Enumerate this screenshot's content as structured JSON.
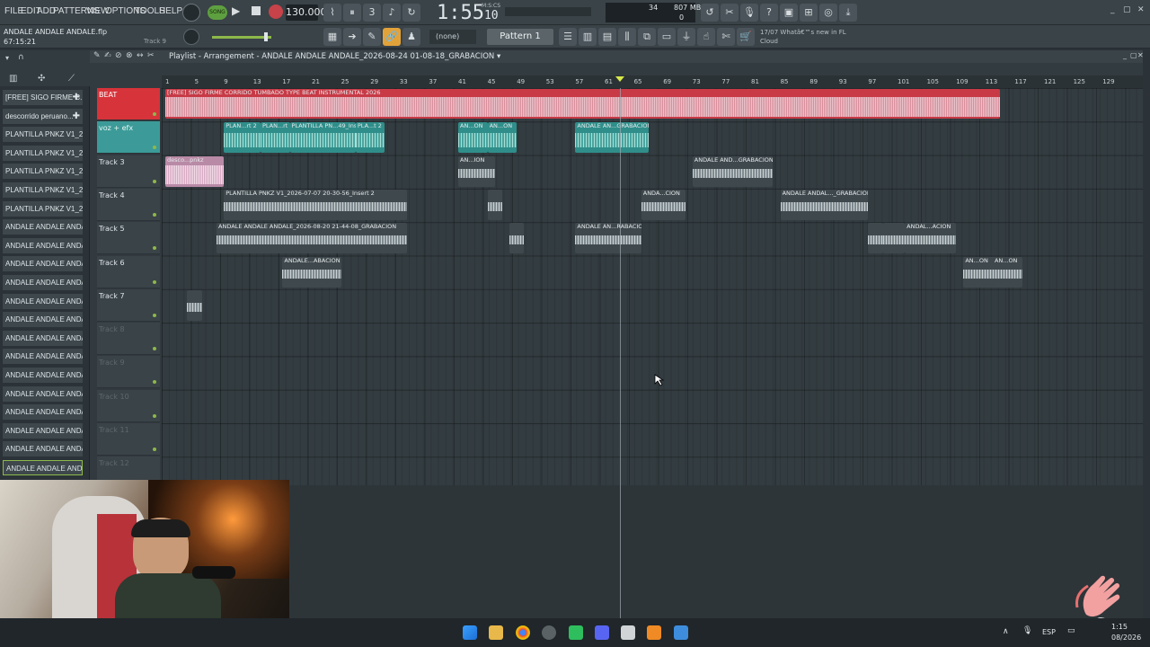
{
  "menu": [
    "FILE",
    "EDIT",
    "ADD",
    "PATTERNS",
    "VIEW",
    "OPTIONS",
    "TOOLS",
    "HELP"
  ],
  "transport": {
    "mode": "SONG",
    "tempo": "130.000",
    "time": "1:55",
    "time_frac": "10",
    "time_unit": "M:S:CS"
  },
  "monitor": {
    "cpu": "34",
    "memory": "807 MB",
    "poly": "0"
  },
  "project": {
    "name": "ANDALE ANDALE ANDALE.flp",
    "time": "67:15:21",
    "track": "Track 9"
  },
  "snap": "(none)",
  "pattern": "Pattern 1",
  "news": {
    "date": "17/07",
    "headline": "Whatâ€™s new in FL",
    "source": "Cloud"
  },
  "browser_items": [
    "[FREE] SIGO FIRME C...",
    "descorrido peruano...",
    "PLANTILLA PNKZ V1_2026...",
    "PLANTILLA PNKZ V1_2026...",
    "PLANTILLA PNKZ V1_2026...",
    "PLANTILLA PNKZ V1_2026...",
    "PLANTILLA PNKZ V1_2026...",
    "ANDALE ANDALE ANDALE_...",
    "ANDALE ANDALE ANDALE_...",
    "ANDALE ANDALE ANDALE_...",
    "ANDALE ANDALE ANDALE_...",
    "ANDALE ANDALE ANDALE_...",
    "ANDALE ANDALE ANDALE_...",
    "ANDALE ANDALE ANDALE_...",
    "ANDALE ANDALE ANDALE_...",
    "ANDALE ANDALE ANDALE_...",
    "ANDALE ANDALE ANDALE_...",
    "ANDALE ANDALE ANDALE_...",
    "ANDALE ANDALE ANDALE_...",
    "ANDALE ANDALE ANDALE_...",
    "ANDALE ANDALE ANDALE_..."
  ],
  "playlist": {
    "title": "Playlist - Arrangement",
    "arrangement": "ANDALE ANDALE ANDALE_2026-08-24 01-08-18_GRABACION",
    "ruler": [
      "1",
      "5",
      "9",
      "13",
      "17",
      "21",
      "25",
      "29",
      "33",
      "37",
      "41",
      "45",
      "49",
      "53",
      "57",
      "61",
      "65",
      "69",
      "73",
      "77",
      "81",
      "85",
      "89",
      "93",
      "97",
      "101",
      "105",
      "109",
      "113",
      "117",
      "121",
      "125",
      "129"
    ],
    "tracks": [
      "BEAT",
      "voz + efx",
      "Track 3",
      "Track 4",
      "Track 5",
      "Track 6",
      "Track 7",
      "Track 8",
      "Track 9",
      "Track 10",
      "Track 11",
      "Track 12"
    ],
    "clip_labels": {
      "beat": "[FREE] SIGO FIRME CORRIDO TUMBADO TYPE BEAT INSTRUMENTAL 2026",
      "voz1": "PLAN...rt 2",
      "voz2": "PLAN...rt",
      "voz3": "PLANTILLA PN...49_Insert 2",
      "voz4": "PLA...t 2",
      "voz5": "AN...ON",
      "voz6": "AN...ON",
      "voz7": "ANDALE AN...GRABACION",
      "t3a": "desco...pnkz",
      "t3b": "AN...ION",
      "t3c": "ANDALE AND...GRABACION",
      "t4a": "PLANTILLA PNKZ V1_2026-07-07 20-30-56_Insert 2",
      "t4b": "ANDA...CION",
      "t4c": "ANDALE ANDAL..._GRABACION",
      "t5a": "ANDALE ANDALE ANDALE_2026-08-20 21-44-08_GRABACION",
      "t5b": "ANDALE AN...RABACION",
      "t5c": "ANDAL...ACION",
      "t6a": "ANDALE...ABACION",
      "t6b": "AN...ON",
      "t6c": "AN...ON"
    }
  },
  "taskbar": {
    "lang": "ESP",
    "time": "1:15",
    "date": "08/2026"
  },
  "sticker": "x6"
}
